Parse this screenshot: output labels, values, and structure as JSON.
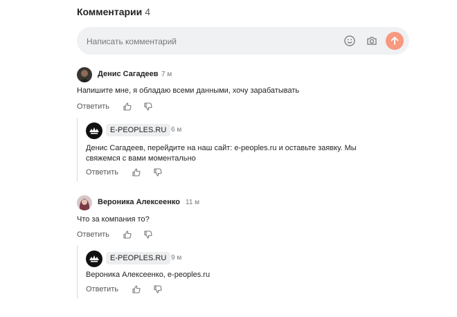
{
  "header": {
    "title": "Комментарии",
    "count": "4"
  },
  "composer": {
    "placeholder": "Написать комментарий",
    "icons": [
      "emoji-icon",
      "camera-icon",
      "send-arrow-icon"
    ],
    "send_color": "#f7997f"
  },
  "comments": [
    {
      "author": "Денис Сагадеев",
      "time": "7 м",
      "text": "Напишите мне, я обладаю всеми данными, хочу зарабатывать",
      "reply_label": "Ответить",
      "replies": [
        {
          "author": "E-PEOPLES.RU",
          "time": "6 м",
          "text_line1": "Денис Сагадеев, перейдите на наш сайт: e-peoples.ru и оставьте заявку. Мы",
          "text_line2": "свяжемся с вами моментально",
          "reply_label": "Ответить"
        }
      ]
    },
    {
      "author": "Вероника Алексеенко",
      "time": "11 м",
      "text": "Что за компания то?",
      "reply_label": "Ответить",
      "replies": [
        {
          "author": "E-PEOPLES.RU",
          "time": "9 м",
          "text": "Вероника Алексеенко, e-peoples.ru",
          "reply_label": "Ответить"
        }
      ]
    }
  ]
}
